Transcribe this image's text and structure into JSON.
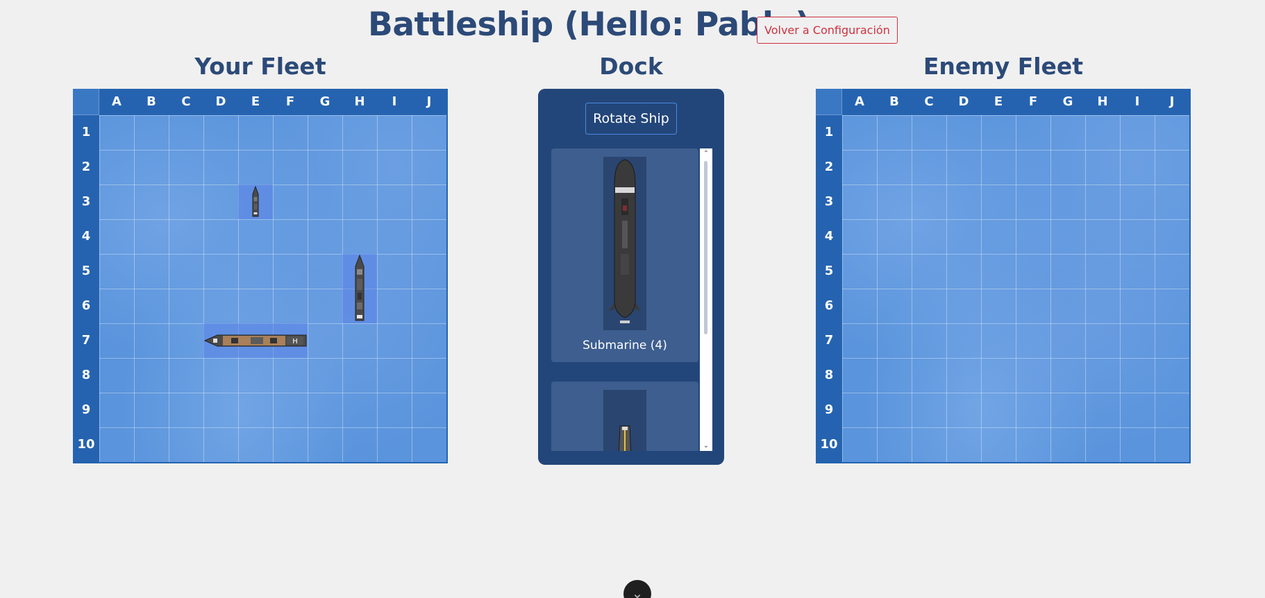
{
  "header": {
    "title": "Battleship (Hello: Pablo)",
    "back_button": "Volver a Configuración"
  },
  "your_fleet": {
    "title": "Your Fleet",
    "columns": [
      "A",
      "B",
      "C",
      "D",
      "E",
      "F",
      "G",
      "H",
      "I",
      "J"
    ],
    "rows": [
      "1",
      "2",
      "3",
      "4",
      "5",
      "6",
      "7",
      "8",
      "9",
      "10"
    ],
    "placed_ships": [
      {
        "name": "patrol-boat",
        "cells": [
          "E3"
        ],
        "orientation": "vertical"
      },
      {
        "name": "destroyer",
        "cells": [
          "H5",
          "H6"
        ],
        "orientation": "vertical"
      },
      {
        "name": "carrier",
        "cells": [
          "D7",
          "E7",
          "F7"
        ],
        "orientation": "horizontal"
      }
    ]
  },
  "dock": {
    "title": "Dock",
    "rotate_button": "Rotate Ship",
    "items": [
      {
        "label": "Submarine (4)"
      },
      {
        "label": ""
      }
    ]
  },
  "enemy_fleet": {
    "title": "Enemy Fleet",
    "columns": [
      "A",
      "B",
      "C",
      "D",
      "E",
      "F",
      "G",
      "H",
      "I",
      "J"
    ],
    "rows": [
      "1",
      "2",
      "3",
      "4",
      "5",
      "6",
      "7",
      "8",
      "9",
      "10"
    ]
  },
  "colors": {
    "title": "#2c4a78",
    "board_frame": "#2563b0",
    "water": "#5a94dc",
    "dock": "#23467a",
    "back_button": "#d0303f"
  },
  "icons": {
    "floating_button": "chevron-down-icon"
  }
}
